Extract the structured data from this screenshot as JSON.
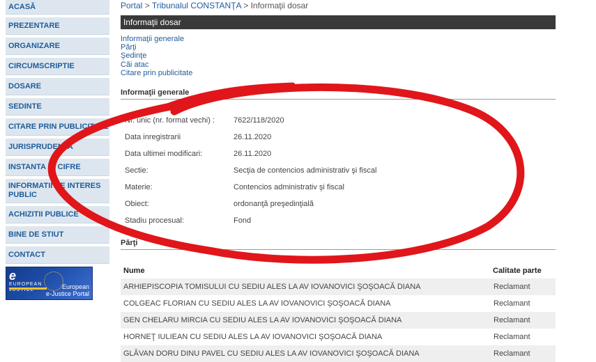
{
  "sidebar": {
    "items": [
      {
        "label": "ACASĂ"
      },
      {
        "label": "PREZENTARE"
      },
      {
        "label": "ORGANIZARE"
      },
      {
        "label": "CIRCUMSCRIPTIE"
      },
      {
        "label": "DOSARE"
      },
      {
        "label": "SEDINTE"
      },
      {
        "label": "CITARE PRIN PUBLICITATE"
      },
      {
        "label": "JURISPRUDENTA"
      },
      {
        "label": "INSTANTA IN CIFRE"
      },
      {
        "label": "INFORMATII DE INTERES PUBLIC"
      },
      {
        "label": "ACHIZITII PUBLICE"
      },
      {
        "label": "BINE DE STIUT"
      },
      {
        "label": "CONTACT"
      }
    ],
    "banner": {
      "logo_text": "EUROPEAN JUSTICE",
      "line1": "European",
      "line2": "e-Justice Portal"
    }
  },
  "breadcrumb": {
    "portal": "Portal",
    "sep1": ">",
    "court": "Tribunalul CONSTANŢA",
    "sep2": ">",
    "current": "Informaţii dosar"
  },
  "section_title": "Informaţii dosar",
  "links": [
    "Informaţii generale",
    "Părţi",
    "Şedinţe",
    "Căi atac",
    "Citare prin publicitate"
  ],
  "general": {
    "title": "Informaţii generale",
    "rows": [
      {
        "label": "Nr. unic (nr. format vechi) :",
        "value": "7622/118/2020"
      },
      {
        "label": "Data inregistrarii",
        "value": "26.11.2020"
      },
      {
        "label": "Data ultimei modificari:",
        "value": "26.11.2020"
      },
      {
        "label": "Sectie:",
        "value": "Secţia de contencios administrativ şi fiscal"
      },
      {
        "label": "Materie:",
        "value": "Contencios administrativ şi fiscal"
      },
      {
        "label": "Obiect:",
        "value": "ordonanţă preşedinţială"
      },
      {
        "label": "Stadiu procesual:",
        "value": "Fond"
      }
    ]
  },
  "parti": {
    "title": "Părţi",
    "headers": {
      "name": "Nume",
      "role": "Calitate parte"
    },
    "rows": [
      {
        "name": "ARHIEPISCOPIA TOMISULUI CU SEDIU ALES LA AV IOVANOVICI ŞOŞOACĂ DIANA",
        "role": "Reclamant"
      },
      {
        "name": "COLGEAC FLORIAN CU SEDIU ALES LA AV IOVANOVICI ŞOŞOACĂ DIANA",
        "role": "Reclamant"
      },
      {
        "name": "GEN CHELARU MIRCIA CU SEDIU ALES LA AV IOVANOVICI ŞOŞOACĂ DIANA",
        "role": "Reclamant"
      },
      {
        "name": "HORNEŢ IULIEAN CU SEDIU ALES LA AV IOVANOVICI ŞOŞOACĂ DIANA",
        "role": "Reclamant"
      },
      {
        "name": "GLĂVAN DORU DINU PAVEL CU SEDIU ALES LA AV IOVANOVICI ŞOŞOACĂ DIANA",
        "role": "Reclamant"
      }
    ]
  },
  "colors": {
    "nav_bg": "#dde6ef",
    "nav_text": "#1f5c99",
    "header_bar": "#3a3a3a",
    "annotation": "#e0161b"
  }
}
